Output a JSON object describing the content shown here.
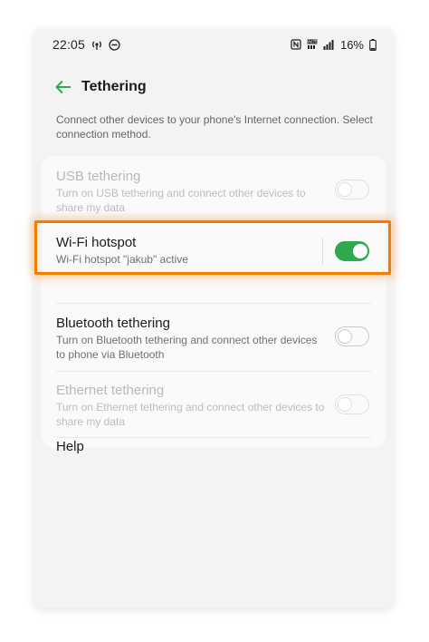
{
  "status_bar": {
    "time": "22:05",
    "battery": "16%",
    "left_icons": [
      "hotspot-status-icon",
      "do-not-disturb-icon"
    ],
    "right_icons": [
      "nfc-icon",
      "wifi-calling-icon",
      "signal-icon",
      "battery-icon"
    ]
  },
  "header": {
    "title": "Tethering",
    "back_icon": "arrow-left-icon"
  },
  "description": "Connect other devices to your phone's Internet connection. Select connection method.",
  "settings": [
    {
      "title": "USB tethering",
      "subtitle": "Turn on USB tethering and connect other devices to share my data",
      "enabled": false,
      "toggled": false
    },
    {
      "title": "Wi-Fi hotspot",
      "subtitle": "Wi-Fi hotspot \"jakub\" active",
      "enabled": true,
      "toggled": true
    },
    {
      "title": "Bluetooth tethering",
      "subtitle": "Turn on Bluetooth tethering and connect other devices to phone via Bluetooth",
      "enabled": true,
      "toggled": false
    },
    {
      "title": "Ethernet tethering",
      "subtitle": "Turn on Ethernet tethering and connect other devices to share my data",
      "enabled": false,
      "toggled": false
    },
    {
      "title": "Help"
    }
  ],
  "colors": {
    "accent": "#2fa84f",
    "highlight": "#f57c00"
  }
}
